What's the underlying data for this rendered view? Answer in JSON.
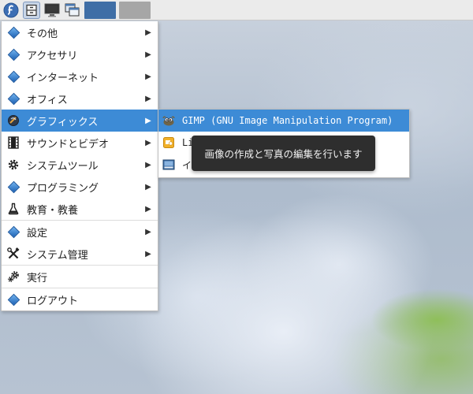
{
  "colors": {
    "selection": "#3d8bd6",
    "tooltip_bg": "#2e2e2e",
    "category_icon": "#2a74c8"
  },
  "panel": {
    "buttons": [
      {
        "icon": "fedora-logo-icon"
      },
      {
        "icon": "file-cabinet-icon"
      },
      {
        "icon": "monitor-icon"
      },
      {
        "icon": "window-stack-icon"
      }
    ],
    "tasks": [
      {
        "state": "active"
      },
      {
        "state": "inactive"
      }
    ]
  },
  "menu": {
    "items": [
      {
        "label": "その他",
        "icon": "category-diamond-icon",
        "submenu": true
      },
      {
        "label": "アクセサリ",
        "icon": "category-diamond-icon",
        "submenu": true
      },
      {
        "label": "インターネット",
        "icon": "category-diamond-icon",
        "submenu": true
      },
      {
        "label": "オフィス",
        "icon": "category-diamond-icon",
        "submenu": true
      },
      {
        "label": "グラフィックス",
        "icon": "graphics-icon",
        "submenu": true,
        "selected": true
      },
      {
        "label": "サウンドとビデオ",
        "icon": "film-strip-icon",
        "submenu": true
      },
      {
        "label": "システムツール",
        "icon": "gear-icon",
        "submenu": true
      },
      {
        "label": "プログラミング",
        "icon": "category-diamond-icon",
        "submenu": true
      },
      {
        "label": "教育・教養",
        "icon": "flask-icon",
        "submenu": true
      },
      {
        "label": "設定",
        "icon": "category-diamond-icon",
        "submenu": true
      },
      {
        "label": "システム管理",
        "icon": "tools-icon",
        "submenu": true
      },
      {
        "label": "実行",
        "icon": "run-gears-icon",
        "submenu": false
      },
      {
        "label": "ログアウト",
        "icon": "category-diamond-icon",
        "submenu": false
      }
    ],
    "arrow": "▶"
  },
  "submenu": {
    "items": [
      {
        "label": "GIMP (GNU Image Manipulation Program)",
        "icon": "gimp-icon",
        "selected": true
      },
      {
        "label": "Li",
        "icon": "libreoffice-draw-icon"
      },
      {
        "label": "イ",
        "icon": "image-viewer-icon"
      }
    ]
  },
  "tooltip": {
    "text": "画像の作成と写真の編集を行います"
  }
}
